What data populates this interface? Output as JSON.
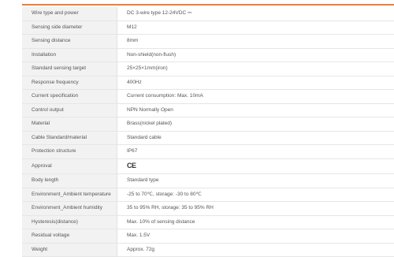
{
  "accent_color": "#e8813a",
  "specs": [
    {
      "label": "Wire type and power",
      "value": "DC 3-wire type 12-24VDC ⎓"
    },
    {
      "label": "Sensing side diameter",
      "value": "M12"
    },
    {
      "label": "Sensing distance",
      "value": "8mm"
    },
    {
      "label": "Installation",
      "value": "Non-shield(non-flush)"
    },
    {
      "label": "Standard sensing target",
      "value": "25×25×1mm(iron)"
    },
    {
      "label": "Response frequency",
      "value": "400Hz"
    },
    {
      "label": "Current specification",
      "value": "Current consumption: Max. 10mA"
    },
    {
      "label": "Control output",
      "value": "NPN Normally Open"
    },
    {
      "label": "Material",
      "value": "Brass(nickel plated)"
    },
    {
      "label": "Cable Standard/material",
      "value": "Standard cable"
    },
    {
      "label": "Protection structure",
      "value": "IP67"
    },
    {
      "label": "Approval",
      "value": "CE"
    },
    {
      "label": "Body length",
      "value": "Standard type"
    },
    {
      "label": "Environment_Ambient temperature",
      "value": "-25 to 70℃, storage: -30 to 80℃"
    },
    {
      "label": "Environment_Ambient humidity",
      "value": "35 to 95% RH, storage: 35 to 95% RH"
    },
    {
      "label": "Hysteresis(distance)",
      "value": "Max. 10% of sensing distance"
    },
    {
      "label": "Residual voltage",
      "value": "Max. 1.5V"
    },
    {
      "label": "Weight",
      "value": "Approx. 72g"
    }
  ]
}
